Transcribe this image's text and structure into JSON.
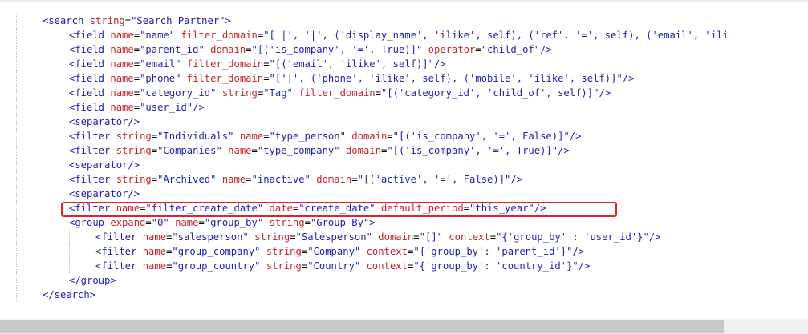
{
  "editor": {
    "lines": [
      {
        "indent": 1,
        "tokens": [
          {
            "t": "<search",
            "k": "tag"
          },
          {
            "t": " ",
            "k": "plain"
          },
          {
            "t": "string",
            "k": "attr"
          },
          {
            "t": "=",
            "k": "eq"
          },
          {
            "t": "\"Search Partner\"",
            "k": "val"
          },
          {
            "t": ">",
            "k": "tag"
          }
        ]
      },
      {
        "indent": 2,
        "tokens": [
          {
            "t": "<field",
            "k": "tag"
          },
          {
            "t": " ",
            "k": "plain"
          },
          {
            "t": "name",
            "k": "attr"
          },
          {
            "t": "=",
            "k": "eq"
          },
          {
            "t": "\"name\"",
            "k": "val"
          },
          {
            "t": " ",
            "k": "plain"
          },
          {
            "t": "filter_domain",
            "k": "attr"
          },
          {
            "t": "=",
            "k": "eq"
          },
          {
            "t": "\"['|', '|', ('display_name', 'ilike', self), ('ref', '=', self), ('email', 'ili",
            "k": "val"
          }
        ]
      },
      {
        "indent": 2,
        "tokens": [
          {
            "t": "<field",
            "k": "tag"
          },
          {
            "t": " ",
            "k": "plain"
          },
          {
            "t": "name",
            "k": "attr"
          },
          {
            "t": "=",
            "k": "eq"
          },
          {
            "t": "\"parent_id\"",
            "k": "val"
          },
          {
            "t": " ",
            "k": "plain"
          },
          {
            "t": "domain",
            "k": "attr"
          },
          {
            "t": "=",
            "k": "eq"
          },
          {
            "t": "\"[('is_company', '=', True)]\"",
            "k": "val"
          },
          {
            "t": " ",
            "k": "plain"
          },
          {
            "t": "operator",
            "k": "attr"
          },
          {
            "t": "=",
            "k": "eq"
          },
          {
            "t": "\"child_of\"",
            "k": "val"
          },
          {
            "t": "/>",
            "k": "tag"
          }
        ]
      },
      {
        "indent": 2,
        "tokens": [
          {
            "t": "<field",
            "k": "tag"
          },
          {
            "t": " ",
            "k": "plain"
          },
          {
            "t": "name",
            "k": "attr"
          },
          {
            "t": "=",
            "k": "eq"
          },
          {
            "t": "\"email\"",
            "k": "val"
          },
          {
            "t": " ",
            "k": "plain"
          },
          {
            "t": "filter_domain",
            "k": "attr"
          },
          {
            "t": "=",
            "k": "eq"
          },
          {
            "t": "\"[('email', 'ilike', self)]\"",
            "k": "val"
          },
          {
            "t": "/>",
            "k": "tag"
          }
        ]
      },
      {
        "indent": 2,
        "tokens": [
          {
            "t": "<field",
            "k": "tag"
          },
          {
            "t": " ",
            "k": "plain"
          },
          {
            "t": "name",
            "k": "attr"
          },
          {
            "t": "=",
            "k": "eq"
          },
          {
            "t": "\"phone\"",
            "k": "val"
          },
          {
            "t": " ",
            "k": "plain"
          },
          {
            "t": "filter_domain",
            "k": "attr"
          },
          {
            "t": "=",
            "k": "eq"
          },
          {
            "t": "\"['|', ('phone', 'ilike', self), ('mobile', 'ilike', self)]\"",
            "k": "val"
          },
          {
            "t": "/>",
            "k": "tag"
          }
        ]
      },
      {
        "indent": 2,
        "tokens": [
          {
            "t": "<field",
            "k": "tag"
          },
          {
            "t": " ",
            "k": "plain"
          },
          {
            "t": "name",
            "k": "attr"
          },
          {
            "t": "=",
            "k": "eq"
          },
          {
            "t": "\"category_id\"",
            "k": "val"
          },
          {
            "t": " ",
            "k": "plain"
          },
          {
            "t": "string",
            "k": "attr"
          },
          {
            "t": "=",
            "k": "eq"
          },
          {
            "t": "\"Tag\"",
            "k": "val"
          },
          {
            "t": " ",
            "k": "plain"
          },
          {
            "t": "filter_domain",
            "k": "attr"
          },
          {
            "t": "=",
            "k": "eq"
          },
          {
            "t": "\"[('category_id', 'child_of', self)]\"",
            "k": "val"
          },
          {
            "t": "/>",
            "k": "tag"
          }
        ]
      },
      {
        "indent": 2,
        "tokens": [
          {
            "t": "<field",
            "k": "tag"
          },
          {
            "t": " ",
            "k": "plain"
          },
          {
            "t": "name",
            "k": "attr"
          },
          {
            "t": "=",
            "k": "eq"
          },
          {
            "t": "\"user_id\"",
            "k": "val"
          },
          {
            "t": "/>",
            "k": "tag"
          }
        ]
      },
      {
        "indent": 2,
        "tokens": [
          {
            "t": "<separator/>",
            "k": "tag"
          }
        ]
      },
      {
        "indent": 2,
        "tokens": [
          {
            "t": "<filter",
            "k": "tag"
          },
          {
            "t": " ",
            "k": "plain"
          },
          {
            "t": "string",
            "k": "attr"
          },
          {
            "t": "=",
            "k": "eq"
          },
          {
            "t": "\"Individuals\"",
            "k": "val"
          },
          {
            "t": " ",
            "k": "plain"
          },
          {
            "t": "name",
            "k": "attr"
          },
          {
            "t": "=",
            "k": "eq"
          },
          {
            "t": "\"type_person\"",
            "k": "val"
          },
          {
            "t": " ",
            "k": "plain"
          },
          {
            "t": "domain",
            "k": "attr"
          },
          {
            "t": "=",
            "k": "eq"
          },
          {
            "t": "\"[('is_company', '=', False)]\"",
            "k": "val"
          },
          {
            "t": "/>",
            "k": "tag"
          }
        ]
      },
      {
        "indent": 2,
        "tokens": [
          {
            "t": "<filter",
            "k": "tag"
          },
          {
            "t": " ",
            "k": "plain"
          },
          {
            "t": "string",
            "k": "attr"
          },
          {
            "t": "=",
            "k": "eq"
          },
          {
            "t": "\"Companies\"",
            "k": "val"
          },
          {
            "t": " ",
            "k": "plain"
          },
          {
            "t": "name",
            "k": "attr"
          },
          {
            "t": "=",
            "k": "eq"
          },
          {
            "t": "\"type_company\"",
            "k": "val"
          },
          {
            "t": " ",
            "k": "plain"
          },
          {
            "t": "domain",
            "k": "attr"
          },
          {
            "t": "=",
            "k": "eq"
          },
          {
            "t": "\"[('is_company', '=', True)]\"",
            "k": "val"
          },
          {
            "t": "/>",
            "k": "tag"
          }
        ]
      },
      {
        "indent": 2,
        "tokens": [
          {
            "t": "<separator/>",
            "k": "tag"
          }
        ]
      },
      {
        "indent": 2,
        "tokens": [
          {
            "t": "<filter",
            "k": "tag"
          },
          {
            "t": " ",
            "k": "plain"
          },
          {
            "t": "string",
            "k": "attr"
          },
          {
            "t": "=",
            "k": "eq"
          },
          {
            "t": "\"Archived\"",
            "k": "val"
          },
          {
            "t": " ",
            "k": "plain"
          },
          {
            "t": "name",
            "k": "attr"
          },
          {
            "t": "=",
            "k": "eq"
          },
          {
            "t": "\"inactive\"",
            "k": "val"
          },
          {
            "t": " ",
            "k": "plain"
          },
          {
            "t": "domain",
            "k": "attr"
          },
          {
            "t": "=",
            "k": "eq"
          },
          {
            "t": "\"[('active', '=', False)]\"",
            "k": "val"
          },
          {
            "t": "/>",
            "k": "tag"
          }
        ]
      },
      {
        "indent": 2,
        "tokens": [
          {
            "t": "<separator/>",
            "k": "tag"
          }
        ]
      },
      {
        "indent": 2,
        "highlighted": true,
        "tokens": [
          {
            "t": "<filter",
            "k": "tag"
          },
          {
            "t": " ",
            "k": "plain"
          },
          {
            "t": "name",
            "k": "attr"
          },
          {
            "t": "=",
            "k": "eq"
          },
          {
            "t": "\"filter_create_date\"",
            "k": "val"
          },
          {
            "t": " ",
            "k": "plain"
          },
          {
            "t": "date",
            "k": "attr"
          },
          {
            "t": "=",
            "k": "eq"
          },
          {
            "t": "\"create_date\"",
            "k": "val"
          },
          {
            "t": " ",
            "k": "plain"
          },
          {
            "t": "default_period",
            "k": "attr"
          },
          {
            "t": "=",
            "k": "eq"
          },
          {
            "t": "\"this_year\"",
            "k": "val"
          },
          {
            "t": "/>",
            "k": "tag"
          }
        ]
      },
      {
        "indent": 2,
        "tokens": [
          {
            "t": "<group",
            "k": "tag"
          },
          {
            "t": " ",
            "k": "plain"
          },
          {
            "t": "expand",
            "k": "attr"
          },
          {
            "t": "=",
            "k": "eq"
          },
          {
            "t": "\"0\"",
            "k": "val"
          },
          {
            "t": " ",
            "k": "plain"
          },
          {
            "t": "name",
            "k": "attr"
          },
          {
            "t": "=",
            "k": "eq"
          },
          {
            "t": "\"group_by\"",
            "k": "val"
          },
          {
            "t": " ",
            "k": "plain"
          },
          {
            "t": "string",
            "k": "attr"
          },
          {
            "t": "=",
            "k": "eq"
          },
          {
            "t": "\"Group By\"",
            "k": "val"
          },
          {
            "t": ">",
            "k": "tag"
          }
        ]
      },
      {
        "indent": 3,
        "tokens": [
          {
            "t": "<filter",
            "k": "tag"
          },
          {
            "t": " ",
            "k": "plain"
          },
          {
            "t": "name",
            "k": "attr"
          },
          {
            "t": "=",
            "k": "eq"
          },
          {
            "t": "\"salesperson\"",
            "k": "val"
          },
          {
            "t": " ",
            "k": "plain"
          },
          {
            "t": "string",
            "k": "attr"
          },
          {
            "t": "=",
            "k": "eq"
          },
          {
            "t": "\"Salesperson\"",
            "k": "val"
          },
          {
            "t": " ",
            "k": "plain"
          },
          {
            "t": "domain",
            "k": "attr"
          },
          {
            "t": "=",
            "k": "eq"
          },
          {
            "t": "\"[]\"",
            "k": "val"
          },
          {
            "t": " ",
            "k": "plain"
          },
          {
            "t": "context",
            "k": "attr"
          },
          {
            "t": "=",
            "k": "eq"
          },
          {
            "t": "\"{'group_by' : 'user_id'}\"",
            "k": "val"
          },
          {
            "t": "/>",
            "k": "tag"
          }
        ]
      },
      {
        "indent": 3,
        "tokens": [
          {
            "t": "<filter",
            "k": "tag"
          },
          {
            "t": " ",
            "k": "plain"
          },
          {
            "t": "name",
            "k": "attr"
          },
          {
            "t": "=",
            "k": "eq"
          },
          {
            "t": "\"group_company\"",
            "k": "val"
          },
          {
            "t": " ",
            "k": "plain"
          },
          {
            "t": "string",
            "k": "attr"
          },
          {
            "t": "=",
            "k": "eq"
          },
          {
            "t": "\"Company\"",
            "k": "val"
          },
          {
            "t": " ",
            "k": "plain"
          },
          {
            "t": "context",
            "k": "attr"
          },
          {
            "t": "=",
            "k": "eq"
          },
          {
            "t": "\"{'group_by': 'parent_id'}\"",
            "k": "val"
          },
          {
            "t": "/>",
            "k": "tag"
          }
        ]
      },
      {
        "indent": 3,
        "tokens": [
          {
            "t": "<filter",
            "k": "tag"
          },
          {
            "t": " ",
            "k": "plain"
          },
          {
            "t": "name",
            "k": "attr"
          },
          {
            "t": "=",
            "k": "eq"
          },
          {
            "t": "\"group_country\"",
            "k": "val"
          },
          {
            "t": " ",
            "k": "plain"
          },
          {
            "t": "string",
            "k": "attr"
          },
          {
            "t": "=",
            "k": "eq"
          },
          {
            "t": "\"Country\"",
            "k": "val"
          },
          {
            "t": " ",
            "k": "plain"
          },
          {
            "t": "context",
            "k": "attr"
          },
          {
            "t": "=",
            "k": "eq"
          },
          {
            "t": "\"{'group_by': 'country_id'}\"",
            "k": "val"
          },
          {
            "t": "/>",
            "k": "tag"
          }
        ]
      },
      {
        "indent": 2,
        "tokens": [
          {
            "t": "</group>",
            "k": "tag"
          }
        ]
      },
      {
        "indent": 1,
        "tokens": [
          {
            "t": "</search>",
            "k": "tag"
          }
        ]
      }
    ]
  }
}
